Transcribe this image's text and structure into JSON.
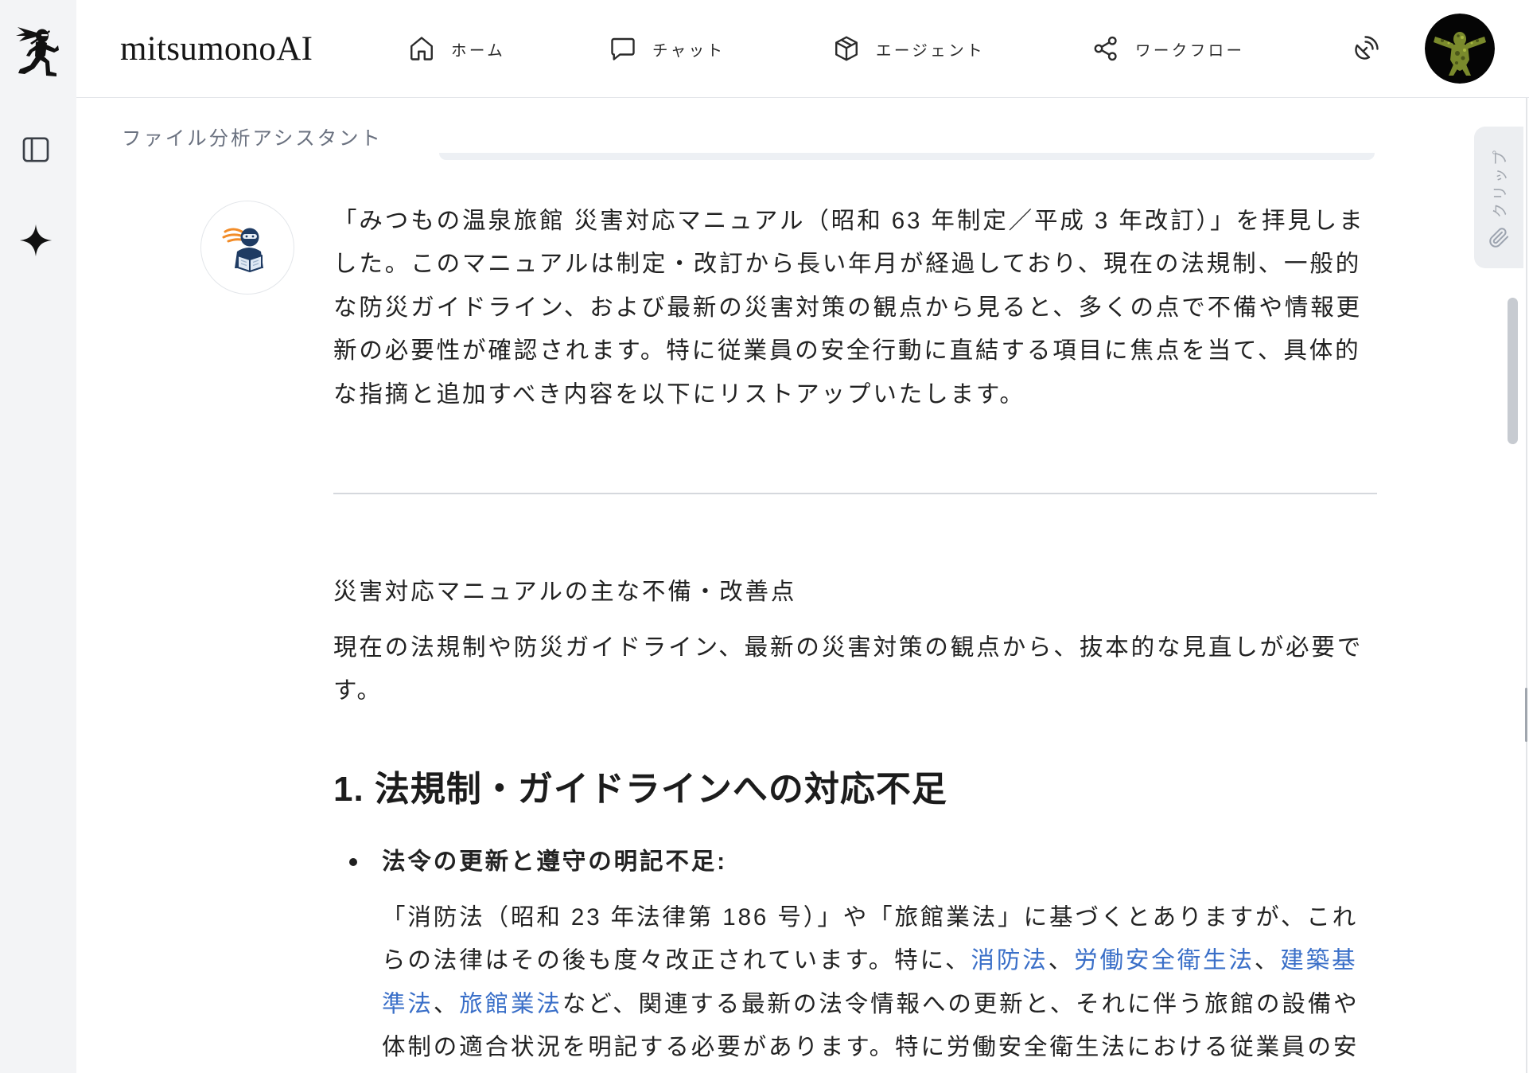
{
  "app": {
    "brand": "mitsumonoAI",
    "logo_icon": "ninja-logo-icon"
  },
  "sidebar": {
    "icons": [
      "ninja-logo-icon",
      "panel-left-icon",
      "sparkle-icon"
    ]
  },
  "nav": {
    "items": [
      {
        "label": "ホーム",
        "icon": "home-icon"
      },
      {
        "label": "チャット",
        "icon": "chat-icon"
      },
      {
        "label": "エージェント",
        "icon": "cube-icon"
      },
      {
        "label": "ワークフロー",
        "icon": "share-icon"
      }
    ],
    "extra_icons": [
      "satellite-dish-icon",
      "user-avatar-icon"
    ]
  },
  "assistant": {
    "name": "ファイル分析アシスタント",
    "avatar_icon": "ninja-reading-icon"
  },
  "message": {
    "intro": "「みつもの温泉旅館 災害対応マニュアル（昭和 63 年制定／平成 3 年改訂）」を拝見しました。このマニュアルは制定・改訂から長い年月が経過しており、現在の法規制、一般的な防災ガイドライン、および最新の災害対策の観点から見ると、多くの点で不備や情報更新の必要性が確認されます。特に従業員の安全行動に直結する項目に焦点を当て、具体的な指摘と追加すべき内容を以下にリストアップいたします。",
    "section_title": "災害対応マニュアルの主な不備・改善点",
    "section_summary": "現在の法規制や防災ガイドライン、最新の災害対策の観点から、抜本的な見直しが必要です。",
    "heading": "1. 法規制・ガイドラインへの対応不足",
    "bullets": [
      {
        "title": "法令の更新と遵守の明記不足:",
        "body": [
          {
            "text": "「消防法（昭和 23 年法律第 186 号）」や「旅館業法」に基づくとありますが、これらの法律はその後も度々改正されています。特に、",
            "link": false
          },
          {
            "text": "消防法",
            "link": true
          },
          {
            "text": "、",
            "link": false
          },
          {
            "text": "労働安全衛生法",
            "link": true
          },
          {
            "text": "、",
            "link": false
          },
          {
            "text": "建築基準法",
            "link": true
          },
          {
            "text": "、",
            "link": false
          },
          {
            "text": "旅館業法",
            "link": true
          },
          {
            "text": "など、関連する最新の法令情報への更新と、それに伴う旅館の設備や体制の適合状況を明記する必要があります。特に労働安全衛生法における従業員の安",
            "link": false
          }
        ]
      }
    ]
  },
  "clip_tab": {
    "label": "クリップ",
    "icon": "paperclip-icon"
  },
  "colors": {
    "text": "#222222",
    "muted": "#6b7280",
    "link": "#3a6fc8",
    "sidebar_bg": "#f3f4f6",
    "accent_orange": "#f28c28",
    "ninja_navy": "#1f3b63"
  }
}
